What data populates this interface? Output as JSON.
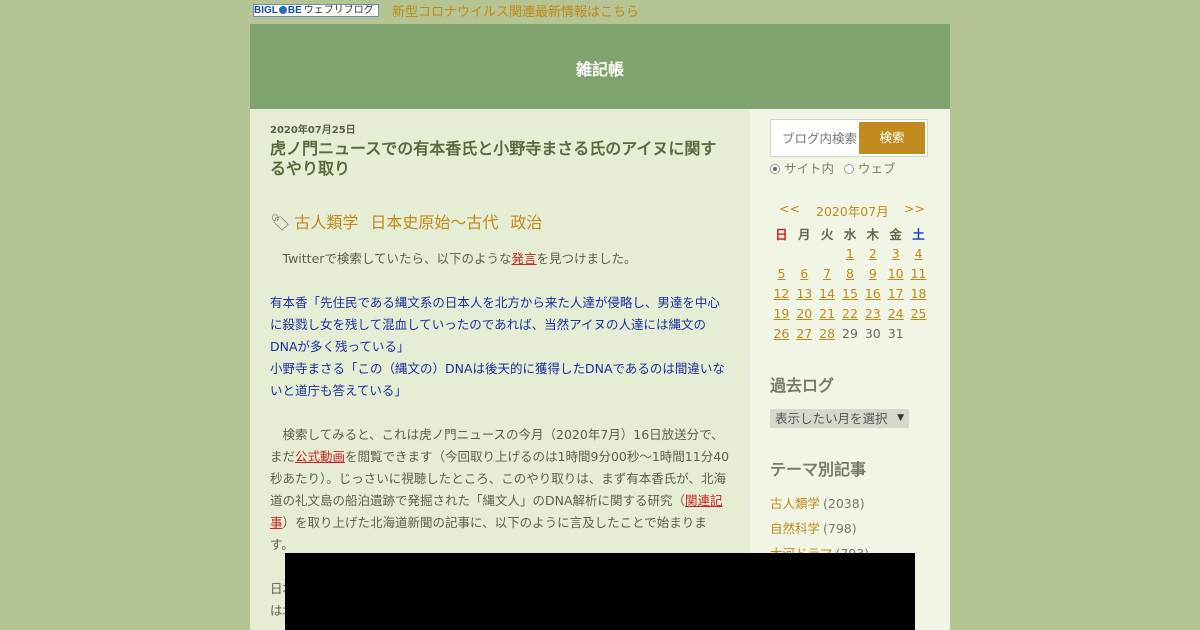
{
  "topbar": {
    "logo_text_a": "BIGL",
    "logo_text_b": "BE",
    "logo_text_c": "ウェブリブログ",
    "covid_link": "新型コロナウイルス関連最新情報はこちら"
  },
  "header": {
    "site_title": "雑記帳"
  },
  "post": {
    "date": "2020年07月25日",
    "title": "虎ノ門ニュースでの有本香氏と小野寺まさる氏のアイヌに関するやり取り",
    "tags": [
      "古人類学",
      "日本史原始～古代",
      "政治"
    ],
    "p1_pre": "　Twitterで検索していたら、以下のような",
    "p1_link": "発言",
    "p1_post": "を見つけました。",
    "quote1": "有本香「先住民である縄文系の日本人を北方から来た人達が侵略し、男達を中心に殺戮し女を残して混血していったのであれば、当然アイヌの人達には縄文のDNAが多く残っている」",
    "quote2": "小野寺まさる「この（縄文の）DNAは後天的に獲得したDNAであるのは間違いないと道庁も答えている」",
    "p2_a": "　検索してみると、これは虎ノ門ニュースの今月（2020年7月）16日放送分で、まだ",
    "p2_link1": "公式動画",
    "p2_b": "を閲覧できます（今回取り上げるのは1時間9分00秒～1時間11分40秒あたり）。じっさいに視聴したところ、このやり取りは、まず有本香氏が、北海道の礼文島の船泊遺跡で発掘された「縄文人」のDNA解析に関する研究（",
    "p2_link2": "関連記事",
    "p2_c": "）を取り上げた北海道新聞の記事に、以下のように言及したことで始まります。",
    "p3_fragment_1": "日本",
    "p3_fragment_2": "は北"
  },
  "sidebar": {
    "search_placeholder": "ブログ内検索",
    "search_button": "検索",
    "radio_site": "サイト内",
    "radio_web": "ウェブ",
    "calendar": {
      "prev": "<<",
      "month": "2020年07月",
      "next": ">>",
      "weekdays": [
        "日",
        "月",
        "火",
        "水",
        "木",
        "金",
        "土"
      ],
      "weeks": [
        [
          "",
          "",
          "",
          "1",
          "2",
          "3",
          "4"
        ],
        [
          "5",
          "6",
          "7",
          "8",
          "9",
          "10",
          "11"
        ],
        [
          "12",
          "13",
          "14",
          "15",
          "16",
          "17",
          "18"
        ],
        [
          "19",
          "20",
          "21",
          "22",
          "23",
          "24",
          "25"
        ],
        [
          "26",
          "27",
          "28",
          "29",
          "30",
          "31",
          ""
        ]
      ],
      "linked_through": 28
    },
    "archive_heading": "過去ログ",
    "archive_select": "表示したい月を選択",
    "theme_heading": "テーマ別記事",
    "themes": [
      {
        "name": "古人類学",
        "count": "(2038)"
      },
      {
        "name": "自然科学",
        "count": "(798)"
      },
      {
        "name": "大河ドラマ",
        "count": "(793)"
      }
    ]
  }
}
